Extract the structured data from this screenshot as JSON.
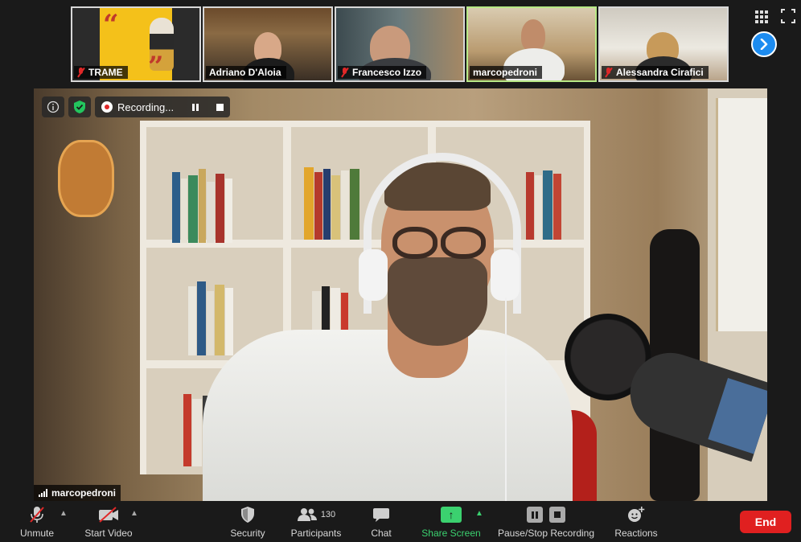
{
  "thumbnails": [
    {
      "name": "TRAME",
      "muted": true,
      "active": false
    },
    {
      "name": "Adriano D'Aloia",
      "muted": false,
      "active": false
    },
    {
      "name": "Francesco Izzo",
      "muted": true,
      "active": false
    },
    {
      "name": "marcopedroni",
      "muted": false,
      "active": true
    },
    {
      "name": "Alessandra Cirafici",
      "muted": true,
      "active": false
    }
  ],
  "trame_quote_open": "“",
  "trame_quote_close": "”",
  "recording": {
    "label": "Recording..."
  },
  "speaker": {
    "name": "marcopedroni"
  },
  "toolbar": {
    "unmute": "Unmute",
    "start_video": "Start Video",
    "security": "Security",
    "participants": "Participants",
    "participants_count": "130",
    "chat": "Chat",
    "share_screen": "Share Screen",
    "pause_stop_recording": "Pause/Stop Recording",
    "reactions": "Reactions",
    "end": "End"
  },
  "colors": {
    "active_border": "#b8e986",
    "share_green": "#3bd16f",
    "end_red": "#e02020",
    "next_blue": "#1d8cf0"
  }
}
